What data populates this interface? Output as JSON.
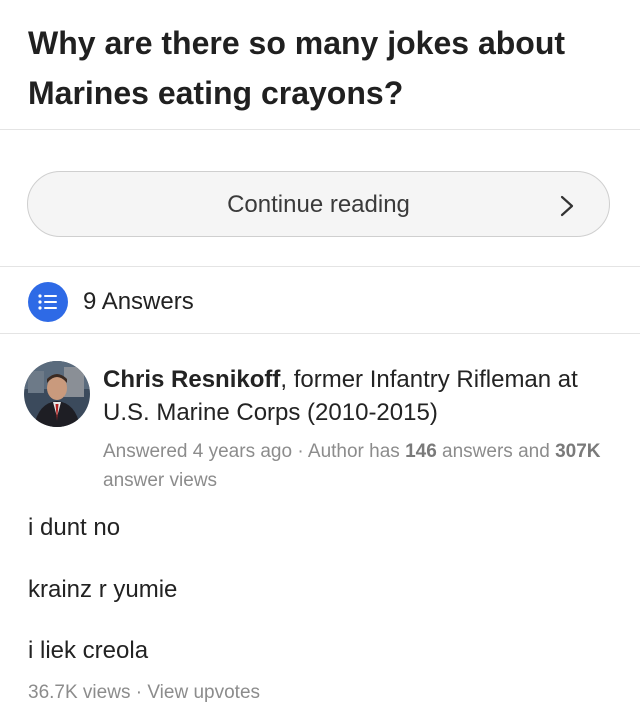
{
  "question": {
    "title": "Why are there so many jokes about Marines eating crayons?"
  },
  "continue_button": {
    "label": "Continue reading",
    "icon": "chevron-right-icon"
  },
  "answers_header": {
    "icon": "list-icon",
    "icon_color": "#2e6ae6",
    "label": "9 Answers"
  },
  "answer": {
    "author_name": "Chris Resnikoff",
    "author_credential": ", former Infantry Rifleman at U.S. Marine Corps (2010-2015)",
    "meta_prefix": "Answered 4 years ago · Author has ",
    "answer_count": "146",
    "meta_mid": " answers and ",
    "view_count": "307K",
    "meta_suffix": " answer views",
    "body": [
      "i dunt no",
      "krainz r yumie",
      "i liek creola"
    ],
    "views": "36.7K views",
    "separator": " · ",
    "upvotes_link": "View upvotes"
  }
}
